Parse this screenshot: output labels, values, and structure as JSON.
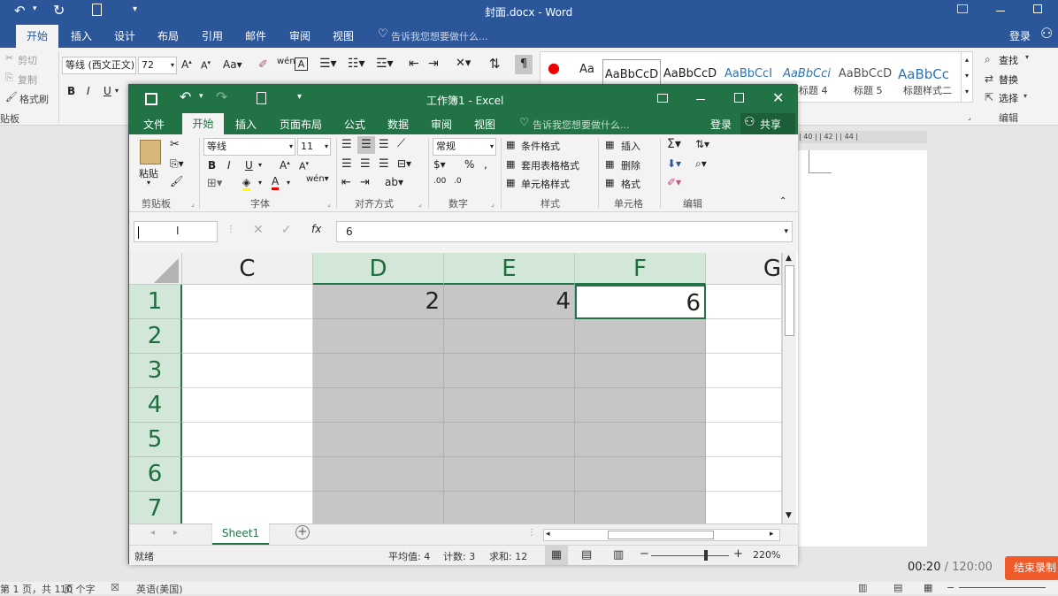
{
  "word": {
    "title": "封面.docx - Word",
    "tabs": [
      "开始",
      "插入",
      "设计",
      "布局",
      "引用",
      "邮件",
      "审阅",
      "视图"
    ],
    "active_tab": "开始",
    "tell_me": "告诉我您想要做什么...",
    "login": "登录",
    "clipboard": {
      "cut": "剪切",
      "copy": "复制",
      "format_painter": "格式刷",
      "group": "贴板"
    },
    "font_name": "等线 (西文正文)",
    "font_size": "72",
    "styles": [
      "AaBbCcD",
      "AaBbCcD",
      "AaBbCcI",
      "AaBbCci",
      "AaBbCcD",
      "AaBbCc"
    ],
    "style_names": [
      "标题 4",
      "标题 5",
      "标题样式二"
    ],
    "edit": {
      "find": "查找",
      "replace": "替换",
      "select": "选择",
      "group": "编辑"
    },
    "ruler": "| 40 |  | 42 |  | 44 |",
    "status": {
      "pages": "第 1 页，共 1 页",
      "words": "10 个字",
      "lang": "英语(美国)"
    }
  },
  "excel": {
    "title": "工作簿1 - Excel",
    "tabs": [
      "文件",
      "开始",
      "插入",
      "页面布局",
      "公式",
      "数据",
      "审阅",
      "视图"
    ],
    "active_tab": "开始",
    "tell_me": "告诉我您想要做什么...",
    "login": "登录",
    "share": "共享",
    "ribbon": {
      "paste": "粘贴",
      "font_name": "等线",
      "font_size": "11",
      "number_format": "常规",
      "cond_format": "条件格式",
      "table_format": "套用表格格式",
      "cell_style": "单元格样式",
      "insert": "插入",
      "delete": "删除",
      "format": "格式",
      "groups": [
        "剪贴板",
        "字体",
        "对齐方式",
        "数字",
        "样式",
        "单元格",
        "编辑"
      ]
    },
    "name_box": "",
    "fx": "fx",
    "formula_value": "6",
    "columns": [
      "C",
      "D",
      "E",
      "F",
      "G"
    ],
    "rows": [
      "1",
      "2",
      "3",
      "4",
      "5",
      "6",
      "7"
    ],
    "cells": {
      "D1": "2",
      "E1": "4",
      "F1": "6"
    },
    "sheet": "Sheet1",
    "status": {
      "ready": "就绪",
      "average": "平均值: 4",
      "count": "计数: 3",
      "sum": "求和: 12",
      "zoom": "220%"
    }
  },
  "recorder": {
    "time": "00:20",
    "total": "/ 120:00",
    "end": "结束录制"
  }
}
